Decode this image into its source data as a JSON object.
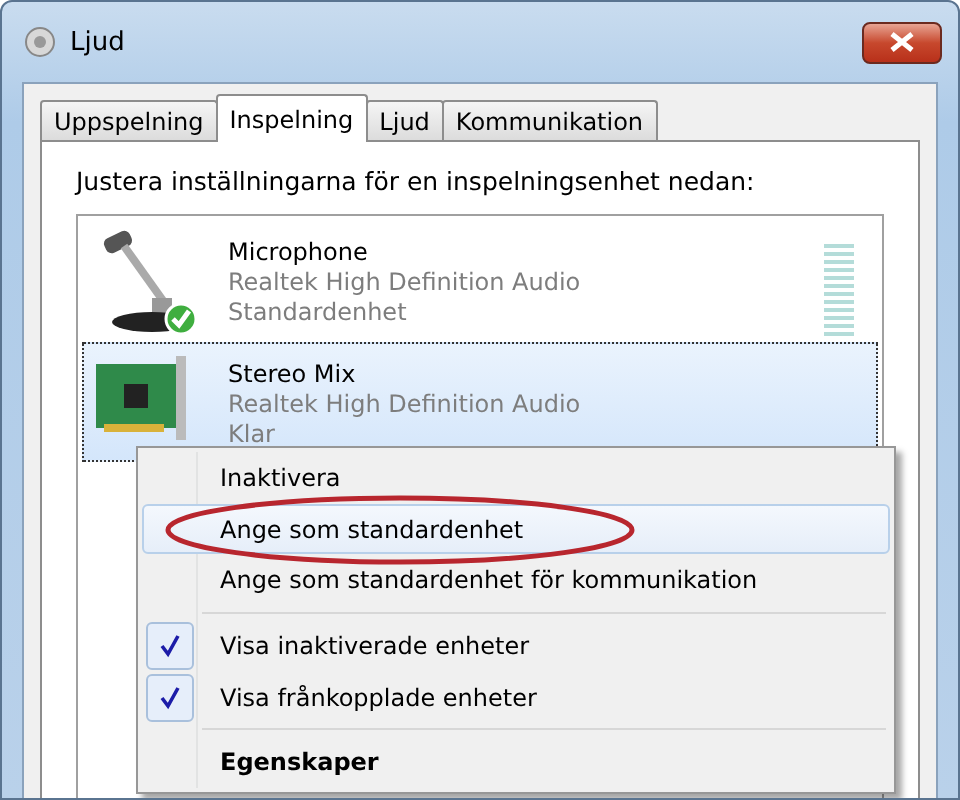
{
  "window": {
    "title": "Ljud"
  },
  "tabs": [
    {
      "label": "Uppspelning",
      "selected": false
    },
    {
      "label": "Inspelning",
      "selected": true
    },
    {
      "label": "Ljud",
      "selected": false
    },
    {
      "label": "Kommunikation",
      "selected": false
    }
  ],
  "instruction": "Justera inställningarna för en inspelningsenhet nedan:",
  "devices": [
    {
      "kind": "microphone",
      "name": "Microphone",
      "driver": "Realtek High Definition Audio",
      "status": "Standardenhet",
      "default": true,
      "selected": false,
      "meter": true
    },
    {
      "kind": "soundcard",
      "name": "Stereo Mix",
      "driver": "Realtek High Definition Audio",
      "status": "Klar",
      "default": false,
      "selected": true,
      "meter": false
    }
  ],
  "context_menu": {
    "items": [
      {
        "kind": "command",
        "label": "Inaktivera",
        "selected": false,
        "checked": false,
        "bold": false,
        "circled": false
      },
      {
        "kind": "command",
        "label": "Ange som standardenhet",
        "selected": true,
        "checked": false,
        "bold": false,
        "circled": true
      },
      {
        "kind": "command",
        "label": "Ange som standardenhet för kommunikation",
        "selected": false,
        "checked": false,
        "bold": false,
        "circled": false
      },
      {
        "kind": "separator"
      },
      {
        "kind": "command",
        "label": "Visa inaktiverade enheter",
        "selected": false,
        "checked": true,
        "bold": false,
        "circled": false
      },
      {
        "kind": "command",
        "label": "Visa frånkopplade enheter",
        "selected": false,
        "checked": true,
        "bold": false,
        "circled": false
      },
      {
        "kind": "separator"
      },
      {
        "kind": "command",
        "label": "Egenskaper",
        "selected": false,
        "checked": false,
        "bold": true,
        "circled": false
      }
    ]
  }
}
